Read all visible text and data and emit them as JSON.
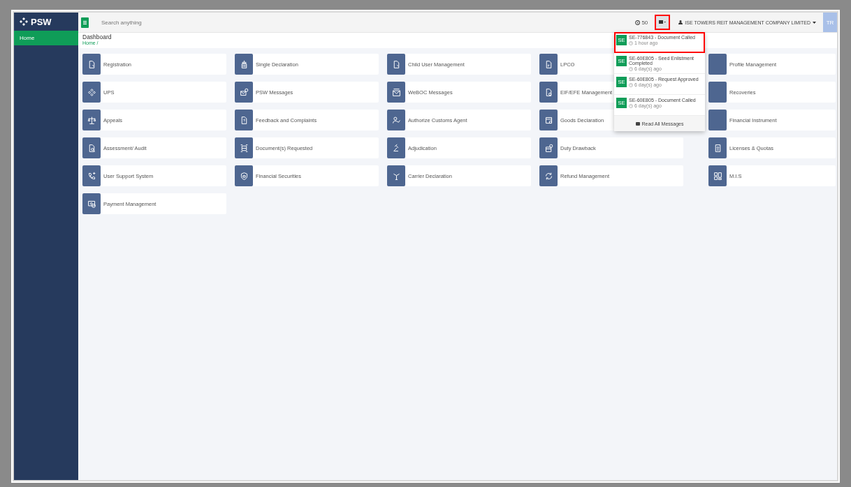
{
  "sidebar": {
    "logo": "PSW",
    "items": [
      {
        "label": "Home",
        "selected": true
      }
    ]
  },
  "topbar": {
    "search": {
      "placeholder": "Search anything"
    },
    "counter": "50",
    "mail_highlighted": true,
    "company": "ISE TOWERS REIT MANAGEMENT COMPANY LIMITED",
    "avatar": "TR"
  },
  "page": {
    "title": "Dashboard",
    "breadcrumb": "Home /"
  },
  "cards": [
    {
      "label": "Registration"
    },
    {
      "label": "Single Declaration"
    },
    {
      "label": "Child User Management"
    },
    {
      "label": "LPCO"
    },
    {
      "label": "Profile Management"
    },
    {
      "label": "UPS"
    },
    {
      "label": "PSW Messages"
    },
    {
      "label": "WeBOC Messages"
    },
    {
      "label": "EIF/EFE Management"
    },
    {
      "label": "Recoveries"
    },
    {
      "label": "Appeals"
    },
    {
      "label": "Feedback and Complaints"
    },
    {
      "label": "Authorize Customs Agent"
    },
    {
      "label": "Goods Declaration"
    },
    {
      "label": "Financial Instrument"
    },
    {
      "label": "Assessment/ Audit"
    },
    {
      "label": "Document(s) Requested"
    },
    {
      "label": "Adjudication"
    },
    {
      "label": "Duty Drawback"
    },
    {
      "label": "Licenses & Quotas"
    },
    {
      "label": "User Support System"
    },
    {
      "label": "Financial Securities"
    },
    {
      "label": "Carrier Declaration"
    },
    {
      "label": "Refund Management"
    },
    {
      "label": "M.I.S"
    },
    {
      "label": "Payment Management"
    }
  ],
  "messages": {
    "items": [
      {
        "avatar": "SE",
        "title": "SE-776843 - Document Called",
        "time": "1 hour ago",
        "highlighted": true
      },
      {
        "avatar": "SE",
        "title": "SE-60E805 - Seed Enlistment Completed",
        "time": "6 day(s) ago",
        "highlighted": false
      },
      {
        "avatar": "SE",
        "title": "SE-60E805 - Request Approved",
        "time": "6 day(s) ago",
        "highlighted": false
      },
      {
        "avatar": "SE",
        "title": "SE-60E805 - Document Called",
        "time": "6 day(s) ago",
        "highlighted": false
      }
    ],
    "footer": "Read All Messages"
  }
}
